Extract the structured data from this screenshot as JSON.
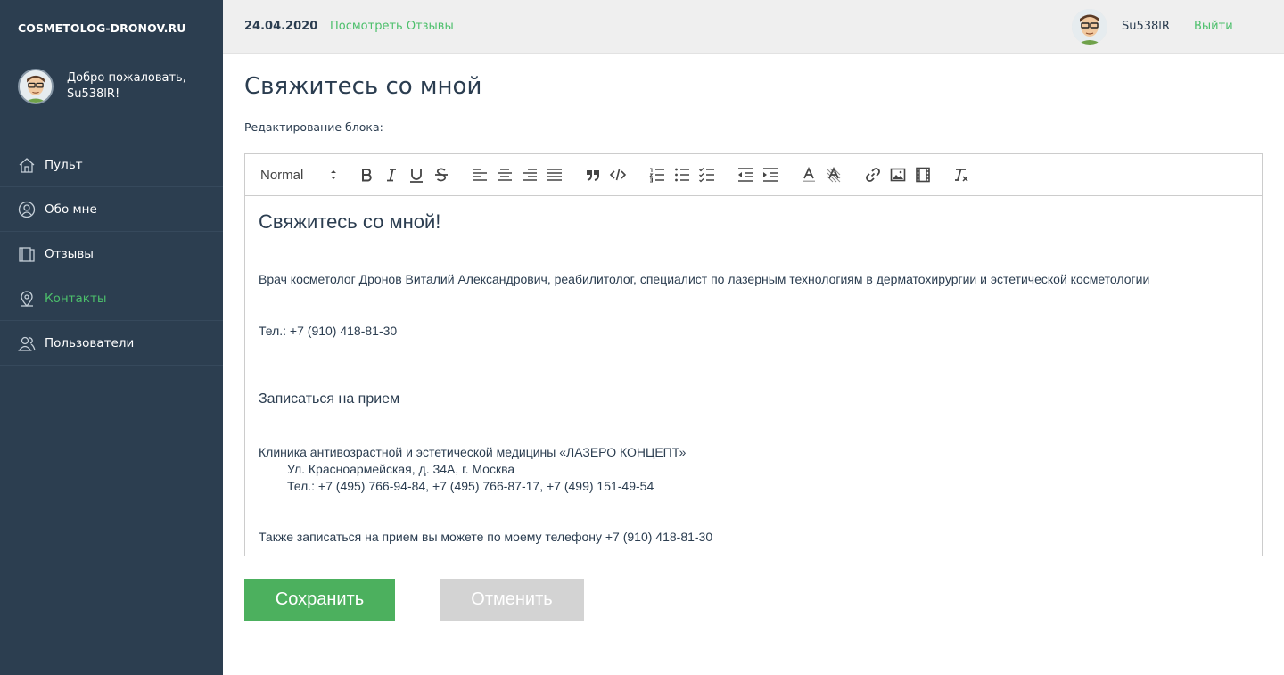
{
  "sidebar": {
    "brand": "COSMETOLOG-DRONOV.RU",
    "welcome": "Добро пожаловать, Su538lR!",
    "items": [
      {
        "label": "Пульт",
        "icon": "home-icon",
        "active": false
      },
      {
        "label": "Обо мне",
        "icon": "user-circle-icon",
        "active": false
      },
      {
        "label": "Отзывы",
        "icon": "book-icon",
        "active": false
      },
      {
        "label": "Контакты",
        "icon": "map-pin-icon",
        "active": true
      },
      {
        "label": "Пользователи",
        "icon": "users-icon",
        "active": false
      }
    ]
  },
  "topbar": {
    "date": "24.04.2020",
    "reviews_link": "Посмотреть Отзывы",
    "username": "Su538lR",
    "logout": "Выйти"
  },
  "main": {
    "title": "Свяжитесь со мной",
    "block_label": "Редактирование блока:",
    "toolbar": {
      "format": "Normal",
      "buttons": [
        "bold-icon",
        "italic-icon",
        "underline-icon",
        "strikethrough-icon",
        "align-left-icon",
        "align-center-icon",
        "align-right-icon",
        "align-justify-icon",
        "blockquote-icon",
        "code-block-icon",
        "ordered-list-icon",
        "bullet-list-icon",
        "check-list-icon",
        "outdent-icon",
        "indent-icon",
        "text-color-icon",
        "background-color-icon",
        "link-icon",
        "image-icon",
        "video-icon",
        "clear-format-icon"
      ]
    },
    "content": {
      "heading": "Свяжитесь со мной!",
      "intro": "Врач косметолог Дронов Виталий Александрович, реабилитолог, специалист по лазерным технологиям в дерматохирургии и эстетической косметологии",
      "phone": "Тел.: +7 (910) 418-81-30",
      "subheading": "Записаться на прием",
      "clinic": "Клиника антивозрастной и эстетической медицины «ЛАЗЕРО КОНЦЕПТ»",
      "address": "Ул. Красноармейская, д. 34А, г. Москва",
      "clinic_phones": "Тел.: +7 (495) 766-94-84, +7 (495) 766-87-17, +7 (499) 151-49-54",
      "also": "Также записаться на прием вы можете по моему телефону +7 (910) 418-81-30"
    },
    "save_label": "Сохранить",
    "cancel_label": "Отменить"
  },
  "colors": {
    "sidebar": "#2c3e50",
    "accent": "#4cbf6b",
    "save_button": "#4cb05e",
    "cancel_button": "#d3d3d3",
    "topbar": "#efefef"
  }
}
